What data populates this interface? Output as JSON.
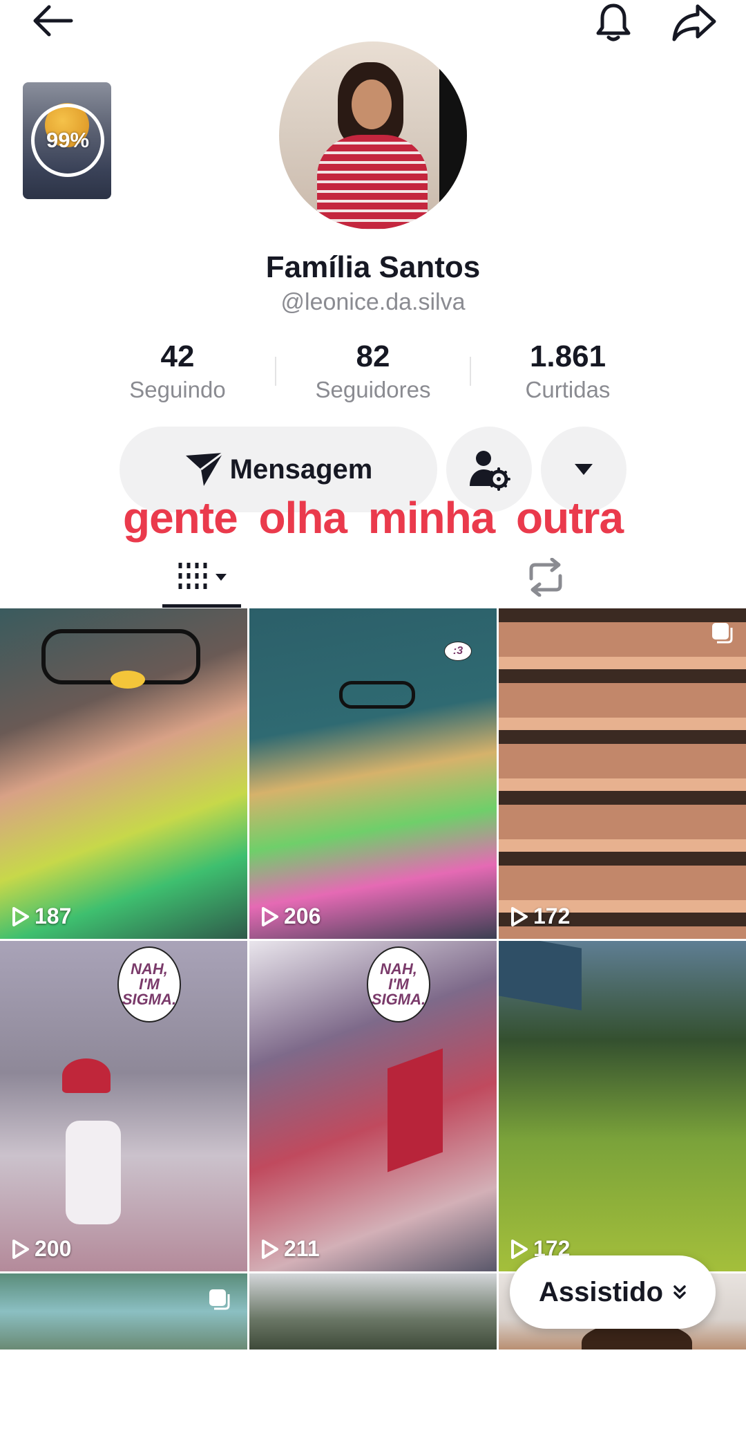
{
  "header": {
    "back_icon": "arrow-left-icon",
    "notification_icon": "bell-icon",
    "share_icon": "share-arrow-icon"
  },
  "story": {
    "progress_label": "99%"
  },
  "profile": {
    "display_name": "Família Santos",
    "username": "@leonice.da.silva"
  },
  "stats": [
    {
      "value": "42",
      "label": "Seguindo"
    },
    {
      "value": "82",
      "label": "Seguidores"
    },
    {
      "value": "1.861",
      "label": "Curtidas"
    }
  ],
  "actions": {
    "message_label": "Mensagem",
    "message_icon": "send-icon",
    "friend_settings_icon": "user-gear-icon",
    "more_icon": "caret-down-icon"
  },
  "overlay_caption": "gente olha  minha  outra",
  "tabs": {
    "videos_icon": "grid-icon",
    "reposts_icon": "repost-icon"
  },
  "videos": [
    {
      "views": "187"
    },
    {
      "views": "206"
    },
    {
      "views": "172"
    },
    {
      "views": "200"
    },
    {
      "views": "211"
    },
    {
      "views": "172"
    }
  ],
  "stickers": {
    "sigma_text": "NAH, I'M SIGMA.",
    "reply_bubble": ":3"
  },
  "watched_filter": {
    "label": "Assistido"
  }
}
